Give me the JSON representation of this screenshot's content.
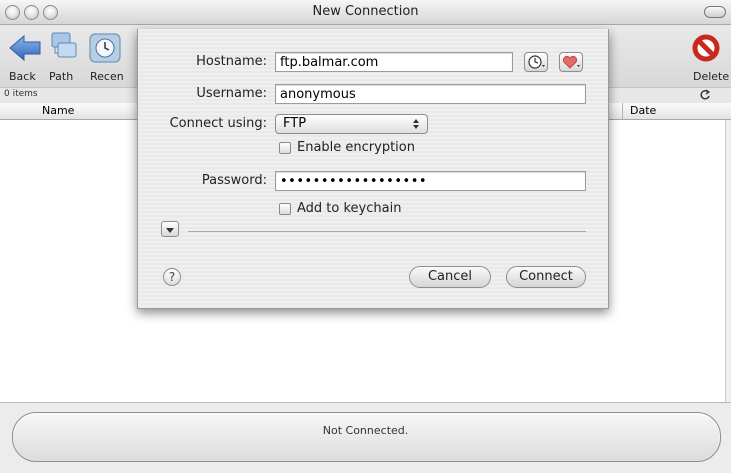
{
  "window": {
    "title": "New Connection"
  },
  "toolbar": {
    "back_label": "Back",
    "path_label": "Path",
    "recent_label": "Recen",
    "delete_label": "Delete"
  },
  "status_line": {
    "items_count": "0 items"
  },
  "columns": {
    "name": "Name",
    "date": "Date"
  },
  "status_bar": {
    "text": "Not Connected."
  },
  "dialog": {
    "hostname": {
      "label": "Hostname:",
      "value": "ftp.balmar.com"
    },
    "username": {
      "label": "Username:",
      "value": "anonymous"
    },
    "connect_using": {
      "label": "Connect using:",
      "value": "FTP"
    },
    "enable_encryption": {
      "label": "Enable encryption",
      "checked": false
    },
    "password": {
      "label": "Password:",
      "value": "••••••••••••••••••"
    },
    "add_to_keychain": {
      "label": "Add to keychain",
      "checked": false
    },
    "help_label": "?",
    "cancel_label": "Cancel",
    "connect_label": "Connect"
  },
  "colors": {
    "delete_icon": "#d7261b",
    "favorites_heart": "#e76a6a",
    "back_arrow": "#3b77c9"
  }
}
